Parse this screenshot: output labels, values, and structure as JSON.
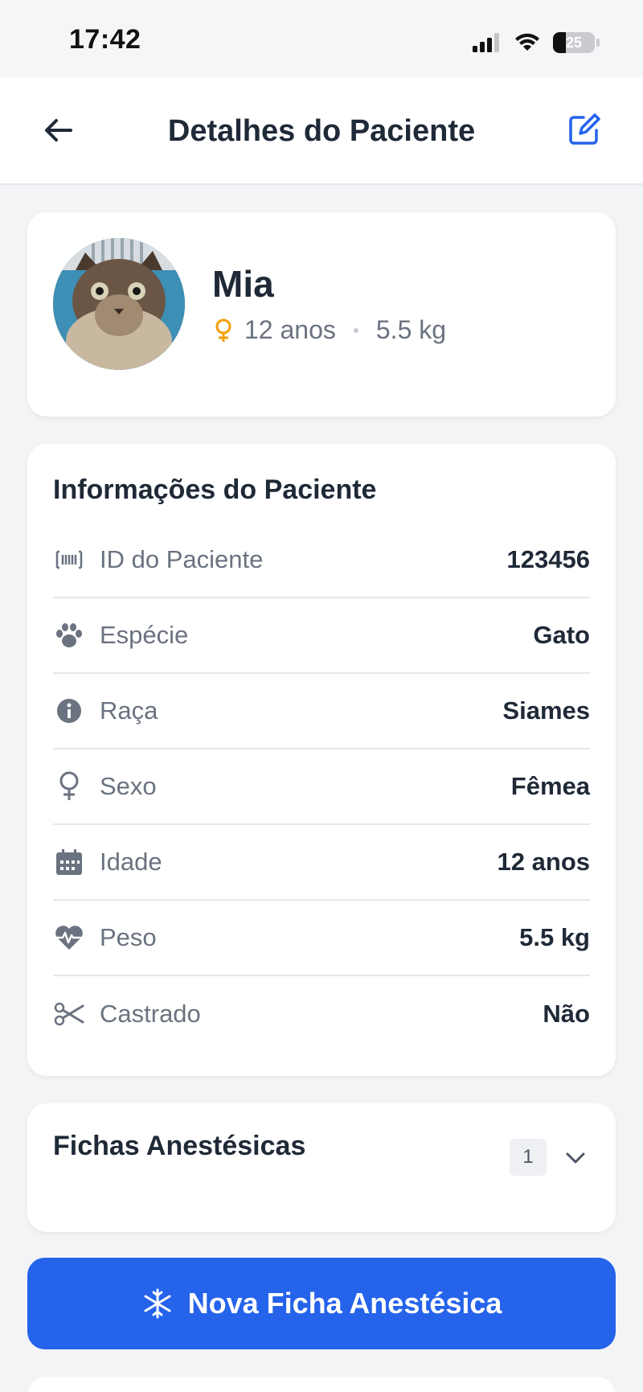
{
  "status_bar": {
    "time": "17:42",
    "battery": "25",
    "icons": [
      "signal-icon",
      "wifi-icon",
      "battery-icon"
    ]
  },
  "header": {
    "title": "Detalhes do Paciente",
    "back_icon": "arrow-left-icon",
    "edit_icon": "edit-square-icon"
  },
  "profile": {
    "name": "Mia",
    "age": "12 anos",
    "weight": "5.5 kg",
    "sex_icon": "female-icon"
  },
  "info": {
    "title": "Informações do Paciente",
    "rows": [
      {
        "icon": "barcode-icon",
        "label": "ID do Paciente",
        "value": "123456"
      },
      {
        "icon": "paw-icon",
        "label": "Espécie",
        "value": "Gato"
      },
      {
        "icon": "info-icon",
        "label": "Raça",
        "value": "Siames"
      },
      {
        "icon": "female-icon",
        "label": "Sexo",
        "value": "Fêmea"
      },
      {
        "icon": "calendar-icon",
        "label": "Idade",
        "value": "12 anos"
      },
      {
        "icon": "heart-pulse-icon",
        "label": "Peso",
        "value": "5.5 kg"
      },
      {
        "icon": "scissors-icon",
        "label": "Castrado",
        "value": "Não"
      }
    ]
  },
  "fichas": {
    "title": "Fichas Anestésicas",
    "count": "1",
    "chevron_icon": "chevron-down-icon"
  },
  "primary_action": {
    "label": "Nova Ficha Anestésica",
    "icon": "snowflake-icon"
  },
  "colors": {
    "accent": "#2563eb",
    "female": "#f59e0b",
    "background": "#f3f4f6"
  }
}
